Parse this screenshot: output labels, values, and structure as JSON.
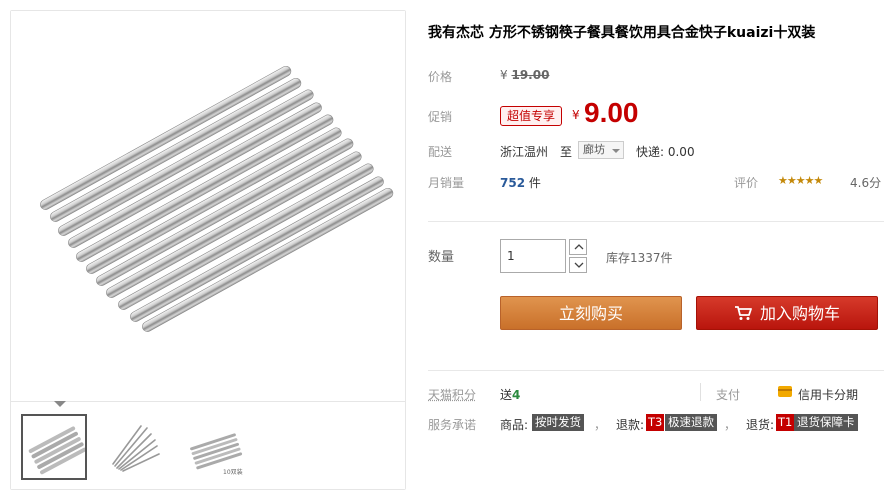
{
  "product": {
    "title": "我有杰芯 方形不锈钢筷子餐具餐饮用具合金快子kuaizi十双装"
  },
  "price": {
    "label": "价格",
    "currency": "¥",
    "original": "19.00"
  },
  "promo": {
    "label": "促销",
    "tag": "超值专享",
    "currency": "¥",
    "price": "9.00"
  },
  "shipping": {
    "label": "配送",
    "from": "浙江温州",
    "to_prefix": "至",
    "destination": "廊坊",
    "fee": "快递: 0.00"
  },
  "sales": {
    "label": "月销量",
    "count": "752",
    "unit": "件"
  },
  "rating": {
    "label": "评价",
    "stars": "★★★★★",
    "score": "4.6分",
    "star_color": "#c4890a"
  },
  "quantity": {
    "label": "数量",
    "value": "1",
    "stock": "库存1337件"
  },
  "buttons": {
    "buy_now": "立刻购买",
    "add_to_cart": "加入购物车"
  },
  "points": {
    "label": "天猫积分",
    "prefix": "送",
    "value": "4"
  },
  "payment": {
    "label": "支付",
    "method": "信用卡分期",
    "icon": "credit-card-icon"
  },
  "service": {
    "label": "服务承诺",
    "goods_prefix": "商品:",
    "goods_tag": "按时发货",
    "refund_prefix": "退款:",
    "refund_badge": "T3",
    "refund_tag": "极速退款",
    "return_prefix": "退货:",
    "return_badge": "T1",
    "return_tag": "退货保障卡",
    "separator": "，"
  },
  "colors": {
    "accent_red": "#c40000",
    "buy_orange": "#d5843c",
    "cart_red": "#c4210f"
  },
  "gallery": {
    "thumbnails": [
      "chopsticks-bundle-thumb",
      "chopsticks-fan-thumb",
      "chopsticks-pack-thumb"
    ],
    "thumb_caption": "10双装",
    "active_index": 0
  }
}
